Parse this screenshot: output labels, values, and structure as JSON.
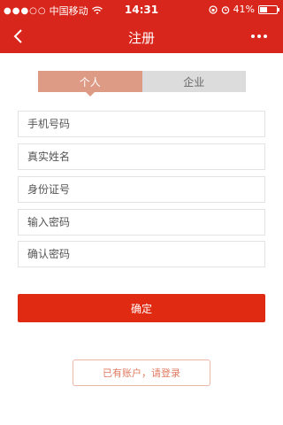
{
  "status_bar": {
    "carrier": "中国移动",
    "time": "14:31",
    "battery": "41%",
    "signal_dots": "●●●○○"
  },
  "nav": {
    "title": "注册"
  },
  "tabs": [
    {
      "label": "个人",
      "active": true
    },
    {
      "label": "企业",
      "active": false
    }
  ],
  "form": {
    "phone_placeholder": "手机号码",
    "name_placeholder": "真实姓名",
    "id_placeholder": "身份证号",
    "password_placeholder": "输入密码",
    "confirm_password_placeholder": "确认密码"
  },
  "buttons": {
    "confirm": "确定",
    "login": "已有账户，请登录"
  },
  "colors": {
    "primary": "#d9261c",
    "tab_active": "#dd9a85",
    "tab_inactive": "#dcdcdc"
  }
}
